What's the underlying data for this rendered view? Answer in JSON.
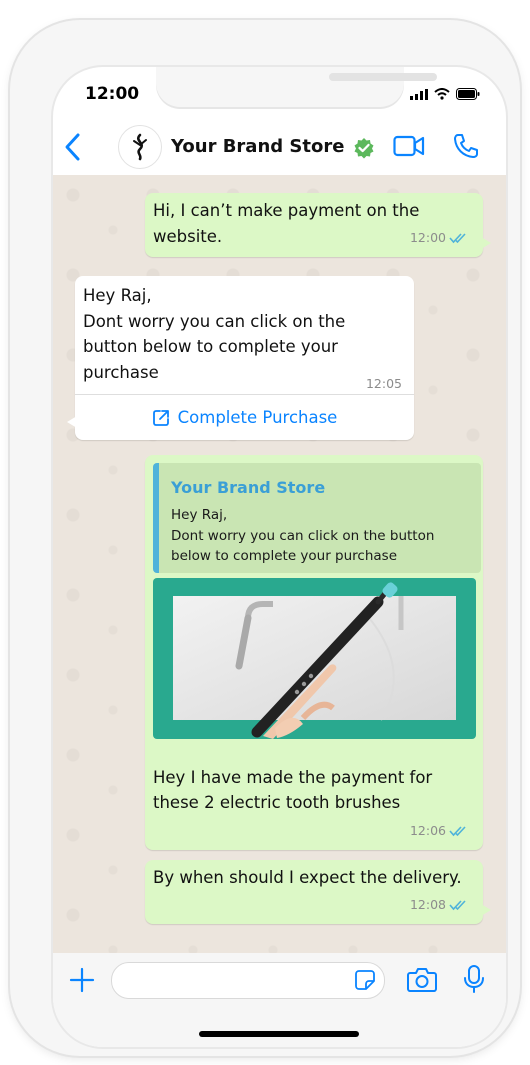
{
  "status_bar": {
    "time": "12:00"
  },
  "header": {
    "contact_name": "Your Brand Store"
  },
  "colors": {
    "accent": "#0a84ff",
    "outgoing_bubble": "#dcf8c6",
    "incoming_bubble": "#ffffff",
    "verified": "#5cb85c",
    "quote_author": "#3a9fd6"
  },
  "messages": [
    {
      "direction": "outgoing",
      "lines": [
        "Hi, I can’t make payment on the",
        "website."
      ],
      "time": "12:00",
      "status": "read"
    },
    {
      "direction": "incoming",
      "lines": [
        "Hey Raj,",
        "Dont worry you can click on the",
        "button below to complete your",
        "purchase"
      ],
      "time": "12:05",
      "action_button": "Complete Purchase"
    },
    {
      "direction": "outgoing",
      "quoted": {
        "author": "Your Brand Store",
        "lines": [
          "Hey Raj,",
          "Dont worry you can click on the button",
          "below to complete your purchase"
        ]
      },
      "image": "electric toothbrush in hand",
      "lines": [
        "Hey I have made the payment for",
        "these 2 electric tooth brushes"
      ],
      "time": "12:06",
      "status": "read"
    },
    {
      "direction": "outgoing",
      "lines": [
        "By when should I expect the delivery."
      ],
      "time": "12:08",
      "status": "read"
    }
  ],
  "input": {
    "placeholder": ""
  },
  "icons": [
    "back-icon",
    "brand-logo-icon",
    "verified-icon",
    "video-call-icon",
    "phone-icon",
    "plus-icon",
    "sticker-icon",
    "camera-icon",
    "mic-icon",
    "external-link-icon",
    "double-check-icon"
  ]
}
